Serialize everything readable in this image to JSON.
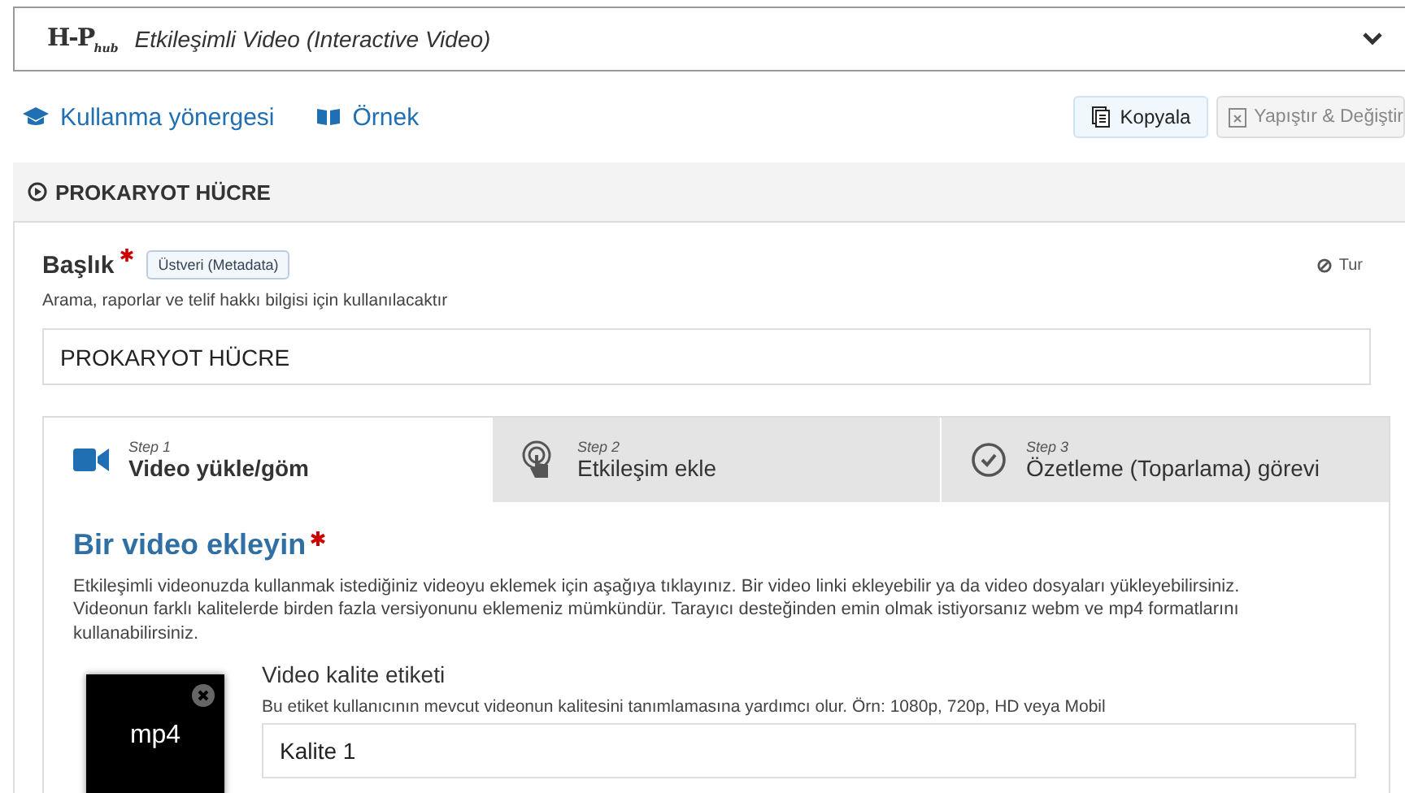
{
  "header": {
    "logo": "H-P",
    "logo_sub": "hub",
    "title": "Etkileşimli Video (Interactive Video)",
    "expanded": true
  },
  "links": [
    {
      "kind": "guide",
      "label": "Kullanma yönergesi"
    },
    {
      "kind": "example",
      "label": "Örnek"
    }
  ],
  "actions": [
    {
      "kind": "copy",
      "label": "Kopyala",
      "disabled": false
    },
    {
      "kind": "paste",
      "label": "Yapıştır & Değiştir",
      "disabled": true
    }
  ],
  "section": {
    "title": "PROKARYOT HÜCRE"
  },
  "title_field": {
    "label": "Başlık",
    "required": true,
    "badge": "Üstveri (Metadata)",
    "tour": "Tur",
    "description": "Arama, raporlar ve telif hakkı bilgisi için kullanılacaktır",
    "value": "PROKARYOT HÜCRE"
  },
  "steps": [
    {
      "kind": "video",
      "step": "Step 1",
      "label": "Video yükle/göm",
      "selected": true
    },
    {
      "kind": "interaction",
      "step": "Step 2",
      "label": "Etkileşim ekle",
      "selected": false
    },
    {
      "kind": "summary",
      "step": "Step 3",
      "label": "Özetleme (Toparlama) görevi",
      "selected": false
    }
  ],
  "video": {
    "heading": "Bir video ekleyin",
    "required": true,
    "description": "Etkileşimli videonuzda kullanmak istediğiniz videoyu eklemek için aşağıya tıklayınız. Bir video linki ekleyebilir ya da video dosyaları yükleyebilirsiniz. Videonun farklı kalitelerde birden fazla versiyonunu eklemeniz mümkündür. Tarayıcı desteğinden emin olmak istiyorsanız webm ve mp4 formatlarını kullanabilirsiniz.",
    "file_label": "mp4",
    "quality_label": "Video kalite etiketi",
    "quality_description": "Bu etiket kullanıcının mevcut videonun kalitesini tanımlamasına yardımcı olur. Örn: 1080p, 720p, HD veya Mobil",
    "quality_value": "Kalite 1"
  }
}
